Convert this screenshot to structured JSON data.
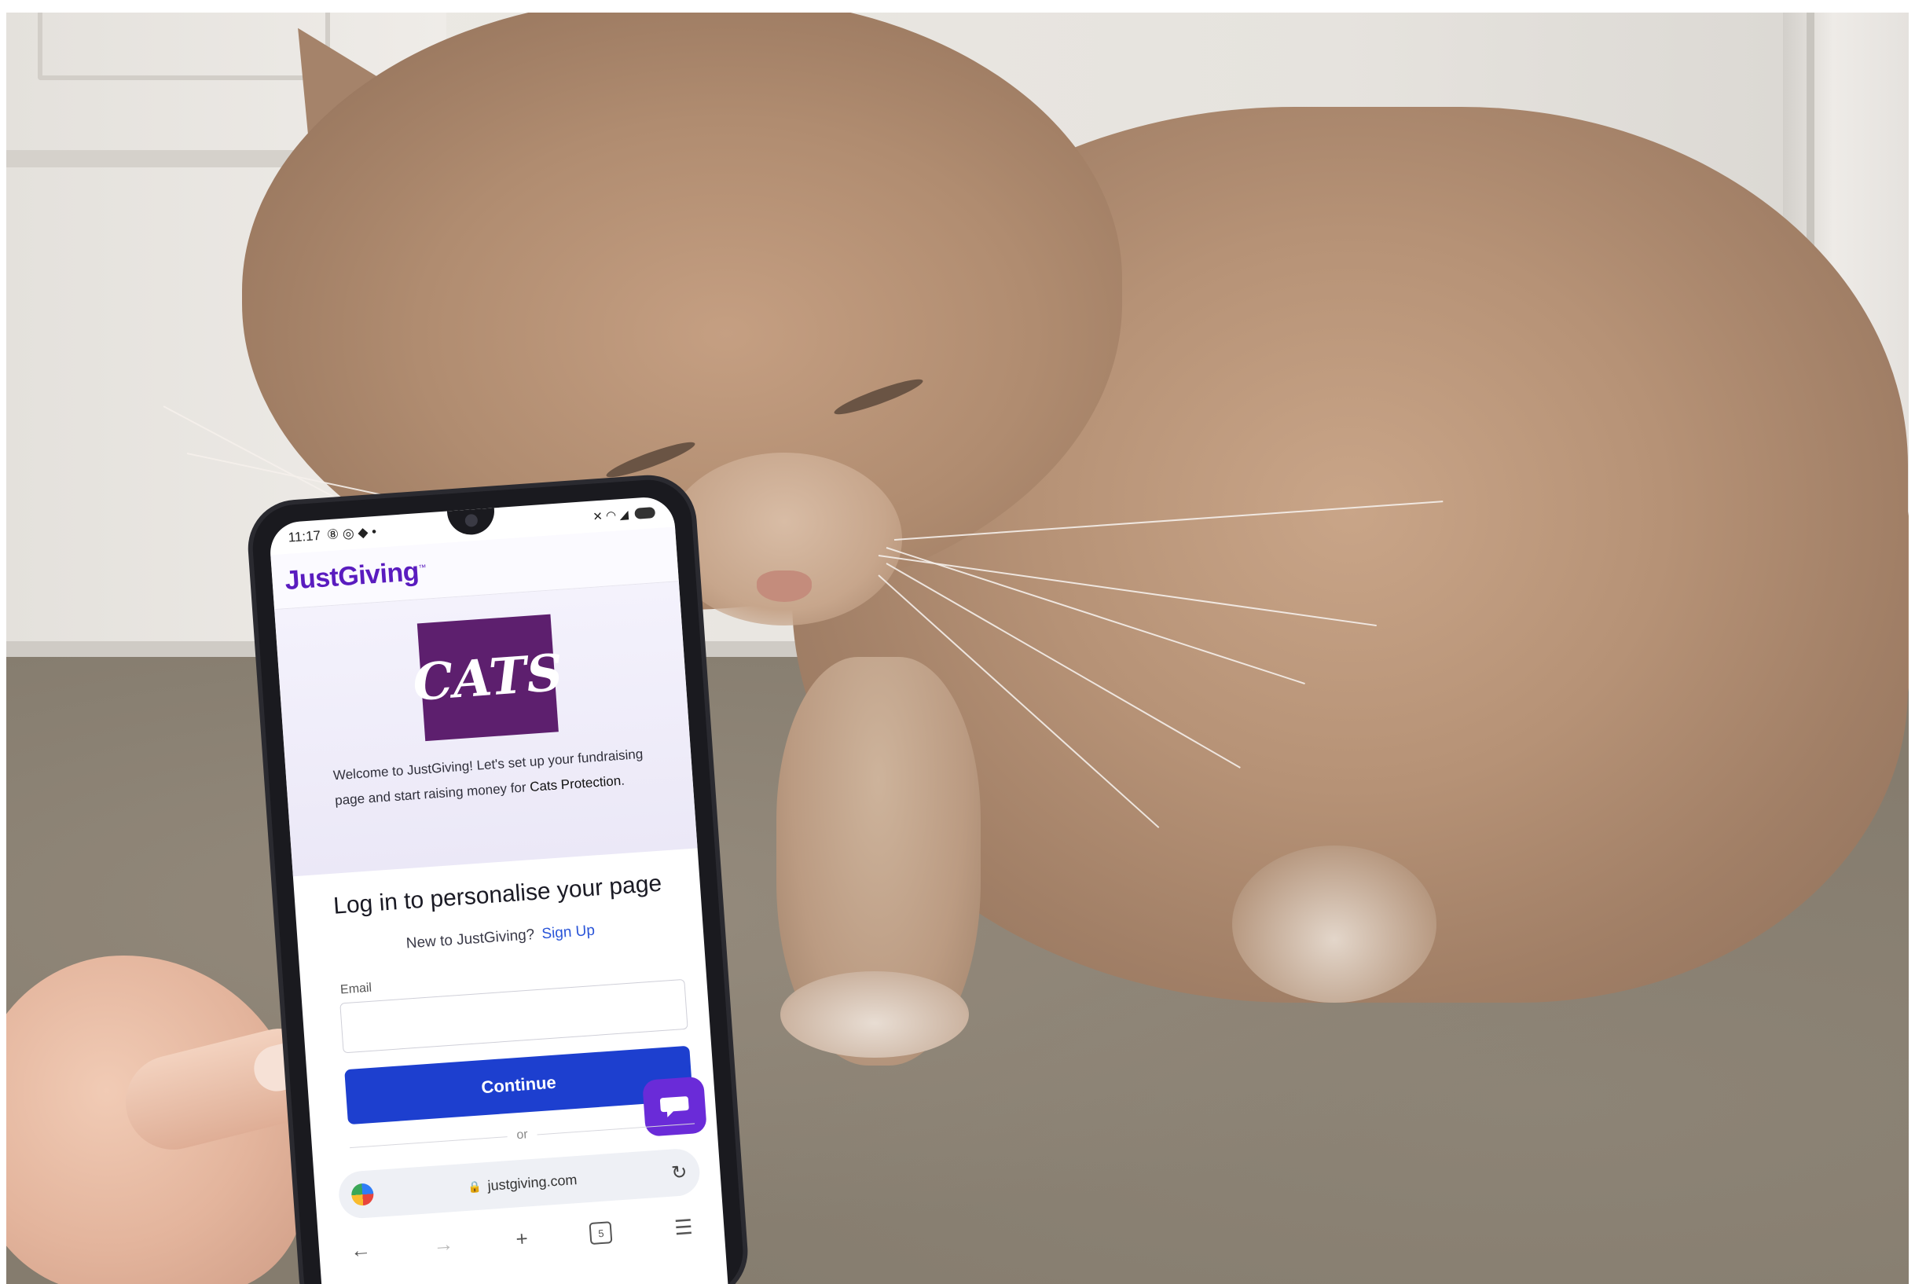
{
  "phone": {
    "status": {
      "time": "11:17",
      "left_icons": "⑧ ◎ ◆ •",
      "right_icons": "✕ ◠ ◢"
    },
    "brand": "JustGiving",
    "brand_mark": "™",
    "charity_logo_text": "CATS",
    "welcome_text": "Welcome to JustGiving! Let's set up your fundraising page and start raising money for",
    "charity_name": "Cats Protection",
    "login_title": "Log in to personalise your page",
    "signup_prompt": "New to JustGiving?",
    "signup_link": "Sign Up",
    "email_label": "Email",
    "email_value": "",
    "continue_label": "Continue",
    "or_label": "or",
    "url": "justgiving.com",
    "tabs_count": "5",
    "colors": {
      "brand": "#5a1cbf",
      "button": "#1d3fcf",
      "logo_bg": "#5d1f6e",
      "chat": "#6a2bd8"
    }
  }
}
